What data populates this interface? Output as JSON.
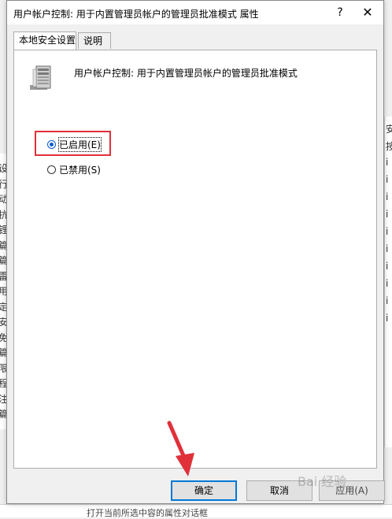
{
  "dialog": {
    "title": "用户帐户控制: 用于内置管理员帐户的管理员批准模式 属性",
    "help_glyph": "?",
    "close_glyph": "✕",
    "tabs": [
      {
        "label": "本地安全设置",
        "active": true
      },
      {
        "label": "说明",
        "active": false
      }
    ],
    "policy_icon": "server-icon",
    "policy_name": "用户帐户控制: 用于内置管理员帐户的管理员批准模式",
    "options": {
      "enabled": {
        "label": "已启用(E)",
        "checked": true
      },
      "disabled": {
        "label": "已禁用(S)",
        "checked": false
      }
    },
    "buttons": {
      "ok": "确定",
      "cancel": "取消",
      "apply": "应用(A)"
    }
  },
  "annotations": {
    "highlight_color": "#e0303a",
    "arrow_color": "#e0303a",
    "watermark": "Bai 经验"
  },
  "background": {
    "left_chars": [
      "设",
      "行",
      "动",
      "抗",
      "锂",
      "篇",
      "篇",
      "雷",
      "用",
      "定",
      "安",
      "免",
      "篇",
      "限",
      "程",
      "注",
      "篇"
    ],
    "right_chars": [
      "安",
      "按",
      "i",
      "i",
      "i",
      "i",
      "i",
      "i",
      "i",
      "i",
      "i",
      "i"
    ],
    "bottom_text": "打开当前所选中容的属性对话框"
  },
  "colors": {
    "accent": "#0078d7",
    "radio_accent": "#0a5bd3"
  }
}
